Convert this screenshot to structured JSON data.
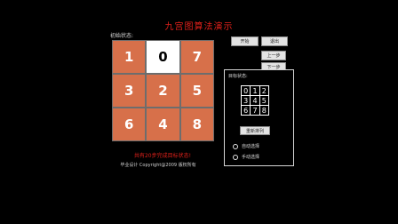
{
  "title": "九宫图算法演示",
  "initial_label": "初始状态:",
  "grid": [
    "1",
    "0",
    "7",
    "3",
    "2",
    "5",
    "6",
    "4",
    "8"
  ],
  "buttons": {
    "top_left": "开始",
    "top_right": "退出",
    "side_up": "上一步",
    "side_down": "下一步",
    "reset": "重新排列"
  },
  "target_label": "目标状态:",
  "target_grid": [
    "0",
    "1",
    "2",
    "3",
    "4",
    "5",
    "6",
    "7",
    "8"
  ],
  "radio": {
    "auto": "自动选择",
    "manual": "手动选择"
  },
  "status_text": "共有20步完成目标状态!",
  "copyright": "毕业设计 Copyright@2009 版权所有",
  "colors": {
    "tile": "#d7704a",
    "blank_tile": "#ffffff",
    "accent_red": "#e0201a",
    "background": "#000000"
  }
}
